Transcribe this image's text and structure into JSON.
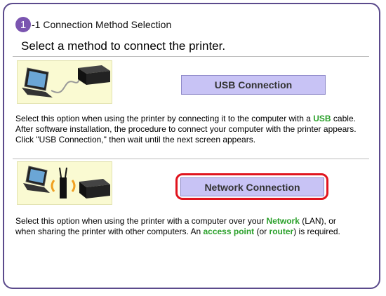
{
  "header": {
    "step_number": "1",
    "step_title": "-1 Connection Method Selection",
    "subtitle": "Select a method to connect the printer."
  },
  "usb": {
    "button_label": "USB Connection",
    "desc_1": "Select this option when using the printer by connecting it to the computer with a ",
    "desc_highlight": "USB",
    "desc_2": " cable. After software installation, the procedure to connect your computer with the printer appears. Click \"USB Connection,\" then wait until the next screen appears."
  },
  "network": {
    "button_label": "Network Connection",
    "desc_1": "Select this option when using the printer with a computer over your ",
    "desc_highlight_1": "Network",
    "desc_2": " (LAN), or when sharing the printer with other computers. An ",
    "desc_highlight_2": "access point",
    "desc_3": " (or ",
    "desc_highlight_3": "router",
    "desc_4": ") is required."
  },
  "colors": {
    "accent": "#7b55b0",
    "button_bg": "#c8c3f5",
    "highlight_text": "#2aa02a",
    "selection_outline": "#e0141e"
  },
  "icons": [
    "laptop-icon",
    "usb-cable-icon",
    "printer-icon",
    "wireless-router-icon"
  ]
}
